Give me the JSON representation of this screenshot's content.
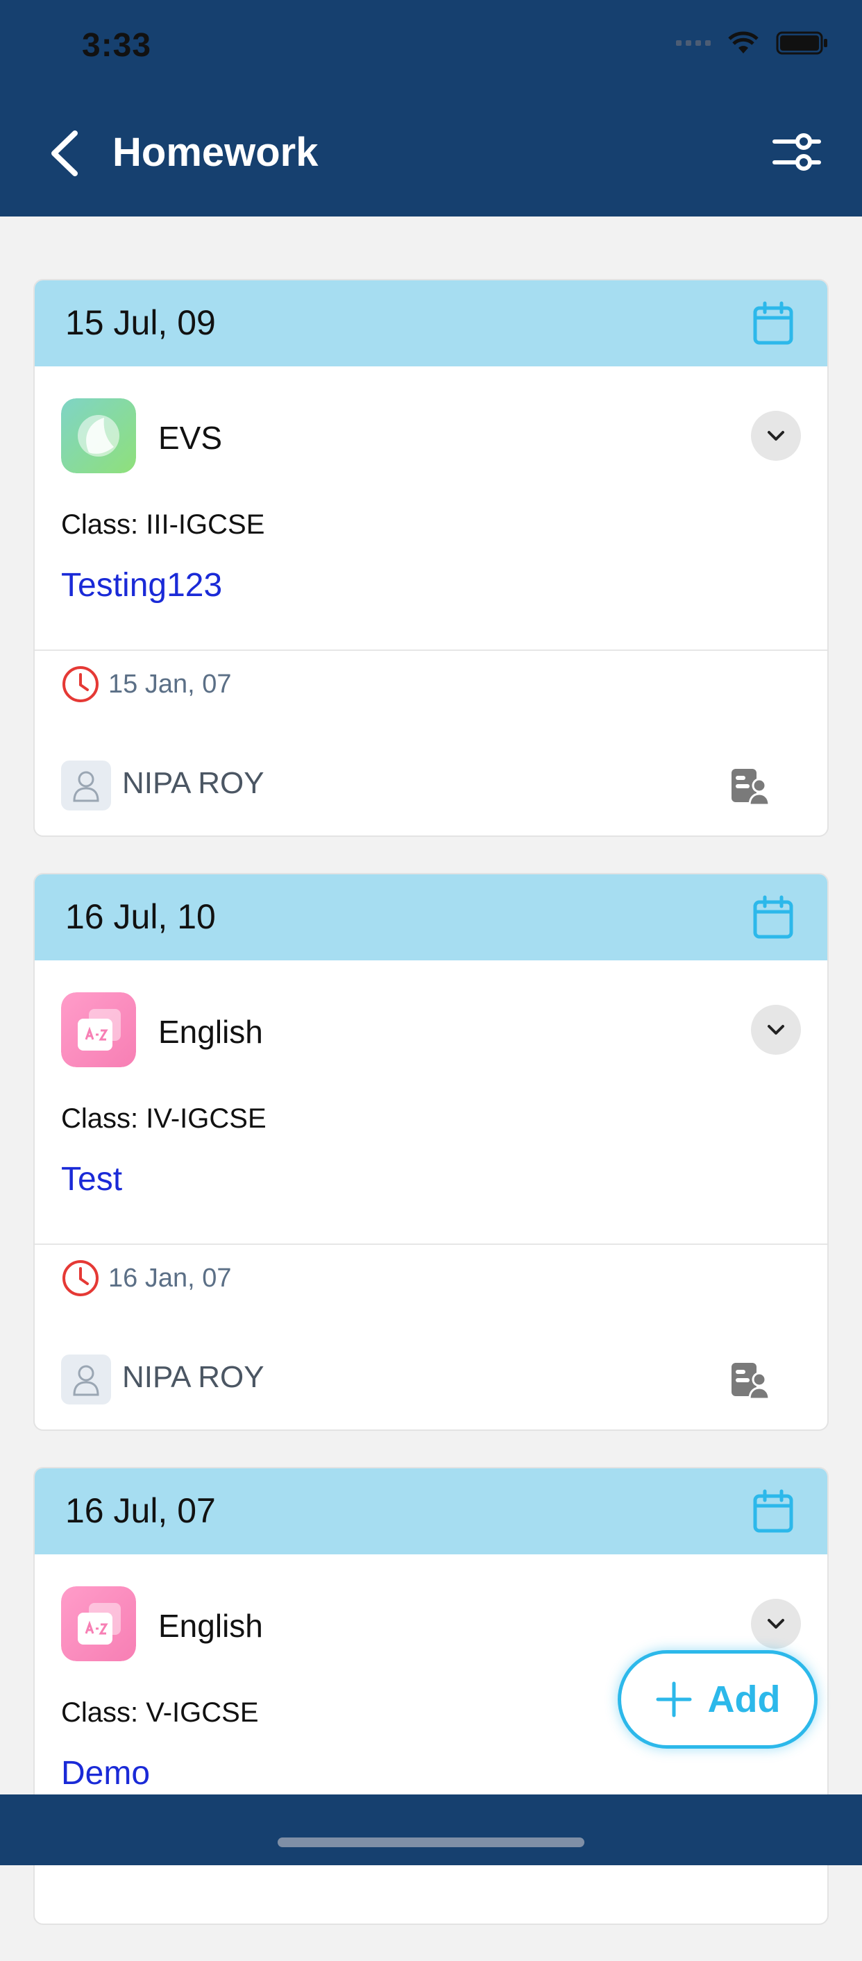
{
  "status_bar": {
    "time": "3:33"
  },
  "header": {
    "title": "Homework"
  },
  "cards": [
    {
      "date": "15 Jul, 09",
      "subject": "EVS",
      "subject_icon": "leaf-icon",
      "class": "Class: III-IGCSE",
      "task": "Testing123",
      "due": "15 Jan, 07",
      "teacher": "NIPA ROY"
    },
    {
      "date": "16 Jul, 10",
      "subject": "English",
      "subject_icon": "a-z-icon",
      "class": "Class: IV-IGCSE",
      "task": "Test",
      "due": "16 Jan, 07",
      "teacher": "NIPA ROY"
    },
    {
      "date": "16 Jul, 07",
      "subject": "English",
      "subject_icon": "a-z-icon",
      "class": "Class: V-IGCSE",
      "task": "Demo",
      "due": "",
      "teacher": ""
    }
  ],
  "fab": {
    "label": "Add"
  },
  "colors": {
    "header_bg": "#16406F",
    "card_head_bg": "#A6DDF1",
    "accent": "#2CB8EA",
    "task_link": "#1a2ad7",
    "due_icon": "#E53935"
  }
}
